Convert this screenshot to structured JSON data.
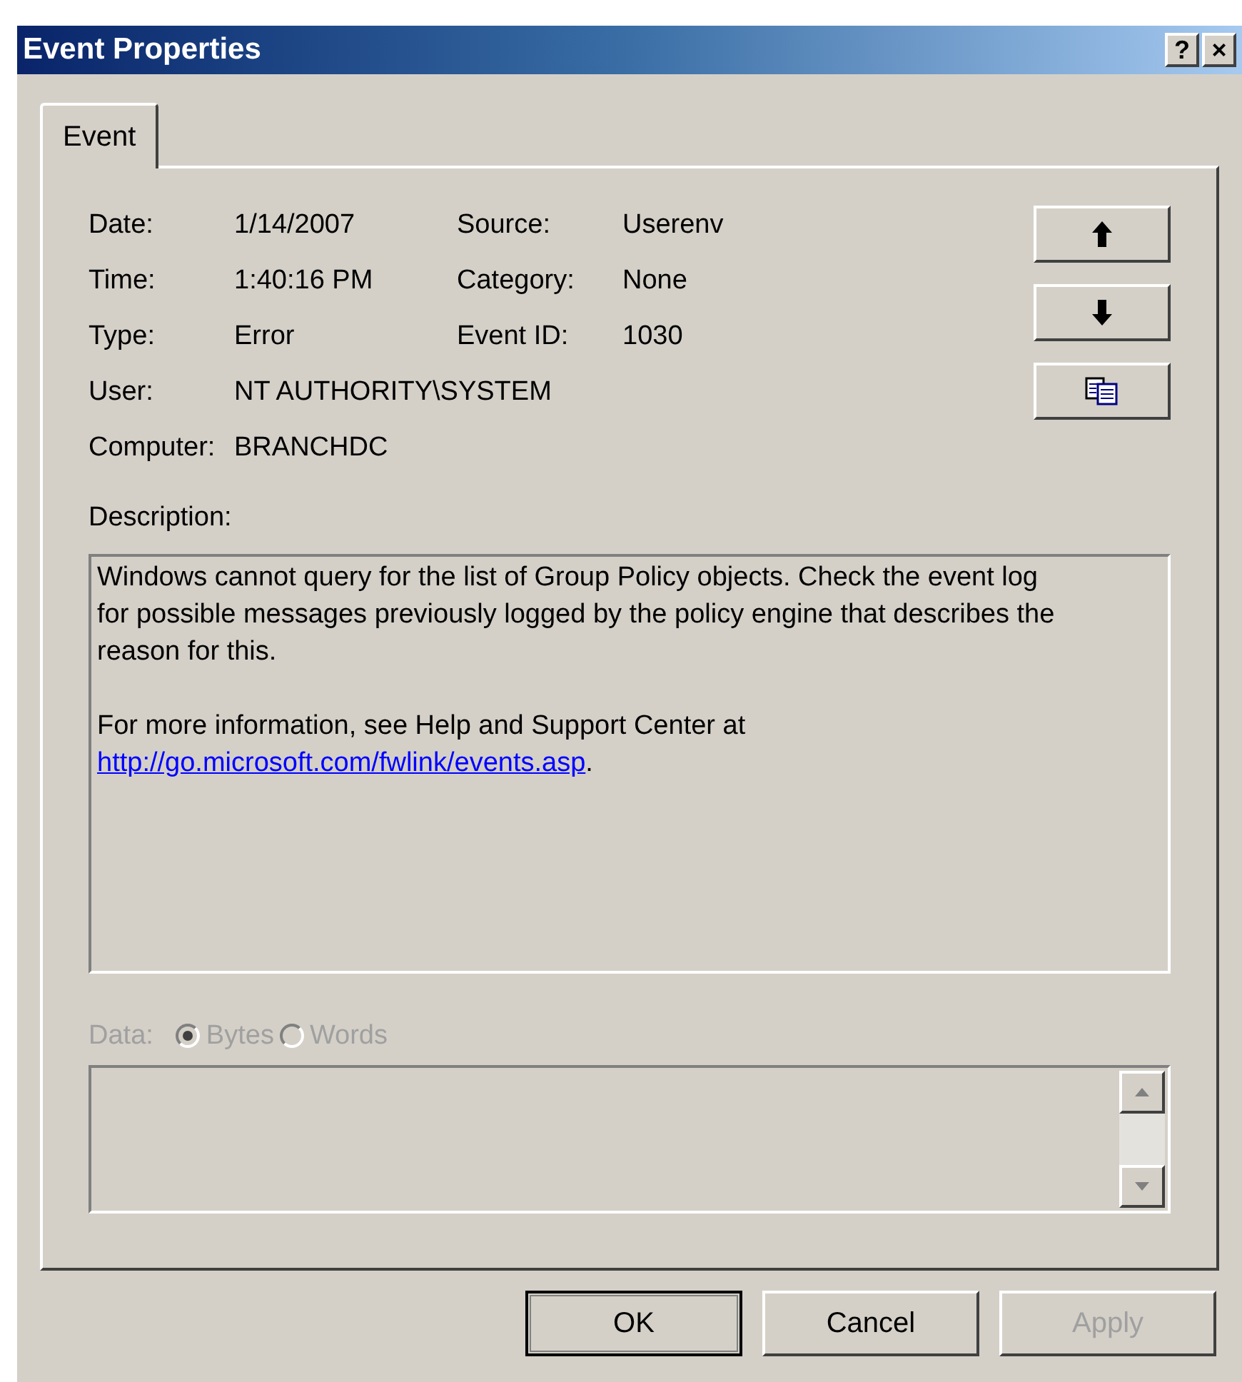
{
  "window": {
    "title": "Event Properties",
    "title_buttons": [
      "?",
      "×"
    ]
  },
  "tabs": [
    {
      "label": "Event",
      "selected": true
    }
  ],
  "fields": [
    {
      "label": "Date:",
      "value": "1/14/2007"
    },
    {
      "label": "Time:",
      "value": "1:40:16 PM"
    },
    {
      "label": "Type:",
      "value": "Error"
    },
    {
      "label": "User:",
      "value": "NT AUTHORITY\\SYSTEM"
    },
    {
      "label": "Computer:",
      "value": "BRANCHDC"
    }
  ],
  "fields_right": [
    {
      "label": "Source:",
      "value": "Userenv"
    },
    {
      "label": "Category:",
      "value": "None"
    },
    {
      "label": "Event ID:",
      "value": "1030"
    }
  ],
  "description": {
    "label": "Description:",
    "paragraphs": [
      {
        "text": "Windows cannot query for the list of Group Policy objects. Check the event log for possible messages previously logged by the policy engine that describes the reason for this."
      },
      {
        "text": "For more information, see Help and Support Center at",
        "link": "http://go.microsoft.com/fwlink/events.asp",
        "after": "."
      }
    ]
  },
  "data": {
    "label": "Data:",
    "disabled": true,
    "options": [
      {
        "label": "Bytes",
        "selected": true
      },
      {
        "label": "Words",
        "selected": false
      }
    ]
  },
  "buttons": [
    {
      "label": "OK",
      "default": true,
      "disabled": false
    },
    {
      "label": "Cancel",
      "default": false,
      "disabled": false
    },
    {
      "label": "Apply",
      "default": false,
      "disabled": true
    }
  ]
}
